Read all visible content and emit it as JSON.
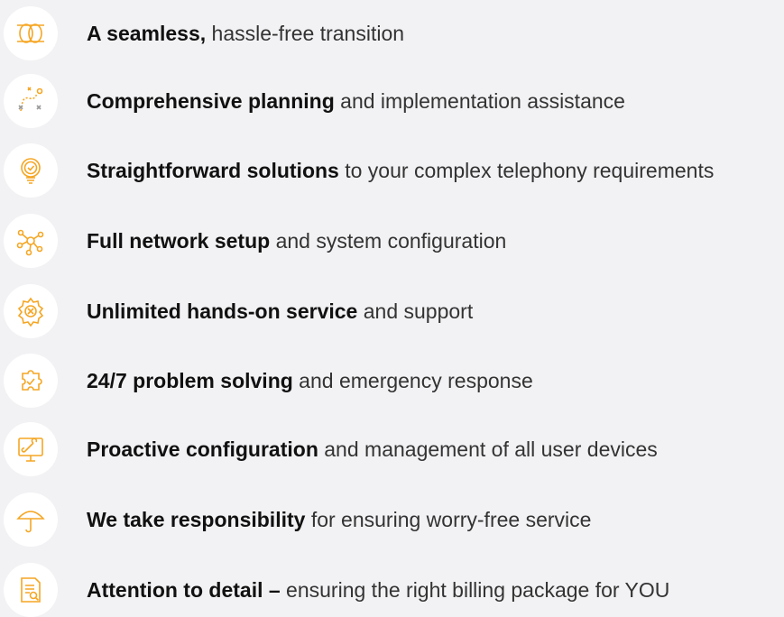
{
  "accent_color": "#f5a623",
  "items": [
    {
      "icon": "rings-icon",
      "bold": "A seamless,",
      "rest": " hassle-free transition"
    },
    {
      "icon": "strategy-path-icon",
      "bold": "Comprehensive planning",
      "rest": " and implementation assistance"
    },
    {
      "icon": "lightbulb-check-icon",
      "bold": "Straightforward solutions",
      "rest": " to your complex telephony requirements"
    },
    {
      "icon": "network-nodes-icon",
      "bold": "Full network setup",
      "rest": " and system configuration"
    },
    {
      "icon": "gear-tools-icon",
      "bold": "Unlimited hands-on service",
      "rest": " and support"
    },
    {
      "icon": "puzzle-check-icon",
      "bold": "24/7 problem solving",
      "rest": " and emergency response"
    },
    {
      "icon": "monitor-wrench-icon",
      "bold": "Proactive configuration",
      "rest": " and management of all user devices"
    },
    {
      "icon": "umbrella-icon",
      "bold": "We take responsibility",
      "rest": " for ensuring worry-free service"
    },
    {
      "icon": "document-search-icon",
      "bold": "Attention to detail –",
      "rest": " ensuring the right billing package for YOU"
    }
  ]
}
